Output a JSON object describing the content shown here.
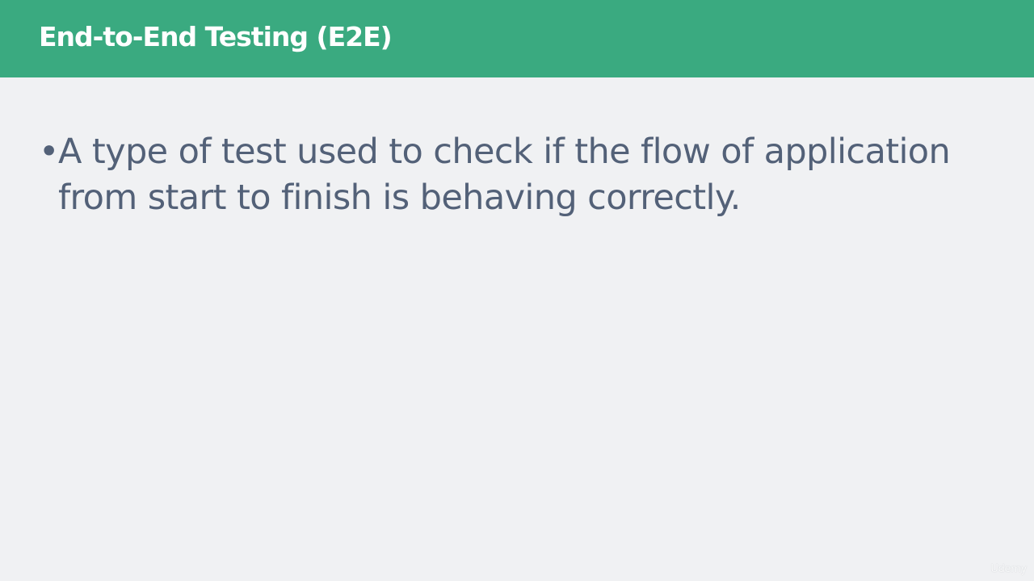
{
  "slide": {
    "title": "End-to-End Testing (E2E)",
    "bullets": [
      {
        "marker": "•",
        "text": "A type of test used to check if the flow of application from start to finish is behaving correctly."
      }
    ],
    "watermark": "Udemy"
  },
  "colors": {
    "title_bar": "#3aaa80",
    "title_text": "#ffffff",
    "background": "#f0f1f3",
    "body_text": "#536178"
  }
}
